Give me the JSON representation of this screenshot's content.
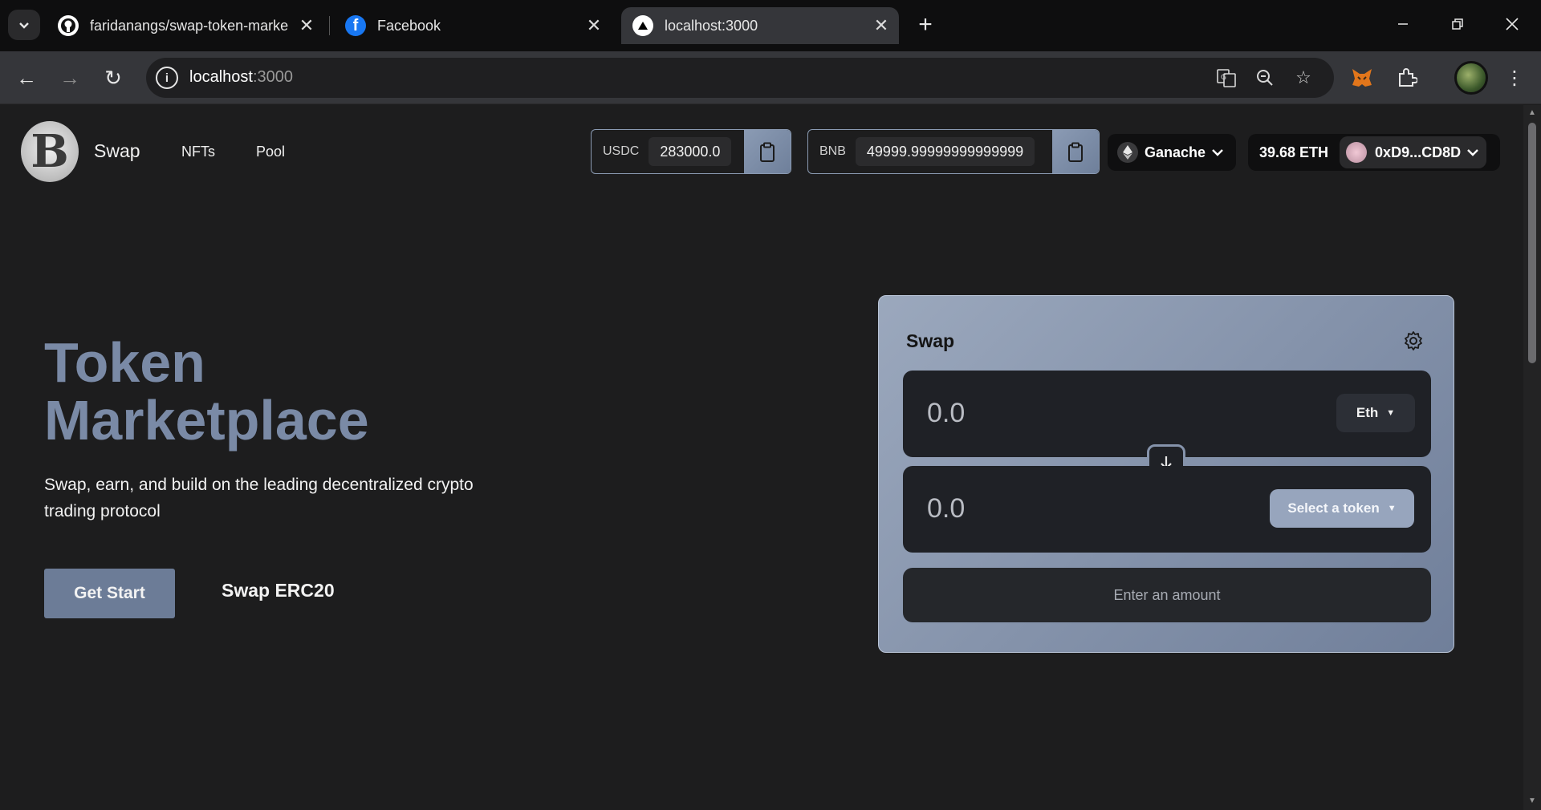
{
  "browser": {
    "tabs": [
      {
        "label": "faridanangs/swap-token-marke",
        "icon": "github-icon"
      },
      {
        "label": "Facebook",
        "icon": "facebook-icon"
      },
      {
        "label": "localhost:3000",
        "icon": "vercel-triangle-icon"
      }
    ],
    "address": {
      "host": "localhost",
      "port": ":3000"
    }
  },
  "header": {
    "nav": {
      "swap": "Swap",
      "nfts": "NFTs",
      "pool": "Pool"
    },
    "tokens": [
      {
        "symbol": "USDC",
        "balance": "283000.0"
      },
      {
        "symbol": "BNB",
        "balance": "49999.99999999999999"
      }
    ],
    "network": "Ganache",
    "account": {
      "balance": "39.68 ETH",
      "address": "0xD9...CD8D"
    }
  },
  "hero": {
    "title_line1": "Token",
    "title_line2": "Marketplace",
    "subtitle": "Swap, earn, and build on the leading decentralized crypto trading protocol",
    "primary_button": "Get Start",
    "secondary_button": "Swap ERC20"
  },
  "swap_card": {
    "title": "Swap",
    "from": {
      "amount": "0.0",
      "token": "Eth"
    },
    "to": {
      "amount": "0.0",
      "token": "Select a token"
    },
    "submit": "Enter an amount"
  },
  "colors": {
    "accent": "#7a8aa6",
    "card_gradient_start": "#9ba8bd",
    "card_gradient_end": "#707f9a",
    "page_bg": "#1d1d1e"
  }
}
